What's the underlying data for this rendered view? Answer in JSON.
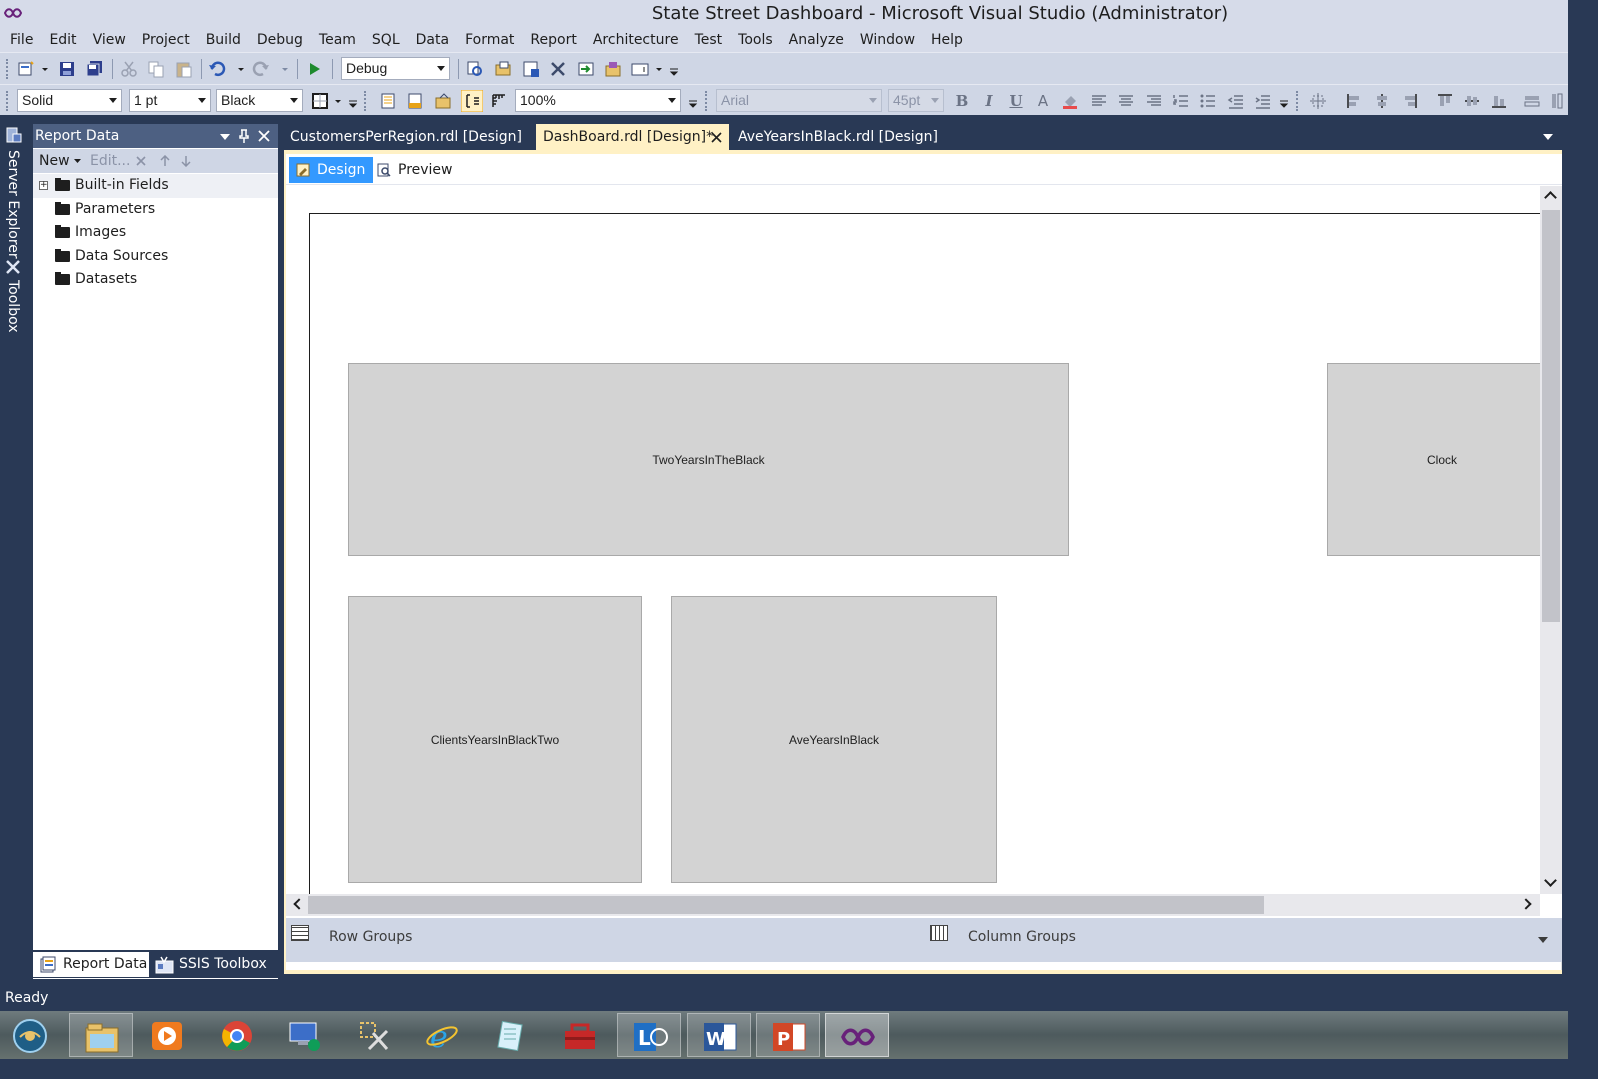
{
  "window": {
    "title": "State Street Dashboard - Microsoft Visual Studio (Administrator)"
  },
  "menu": [
    "File",
    "Edit",
    "View",
    "Project",
    "Build",
    "Debug",
    "Team",
    "SQL",
    "Data",
    "Format",
    "Report",
    "Architecture",
    "Test",
    "Tools",
    "Analyze",
    "Window",
    "Help"
  ],
  "toolbar1": {
    "config": "Debug"
  },
  "toolbar2": {
    "border_style": "Solid",
    "border_width": "1 pt",
    "border_color": "Black",
    "zoom": "100%",
    "font_name": "Arial",
    "font_size": "45pt",
    "bold": "B",
    "italic": "I",
    "underline": "U",
    "font_color": "A"
  },
  "side_tabs": {
    "server_explorer": "Server Explorer",
    "toolbox": "Toolbox"
  },
  "report_data": {
    "title": "Report Data",
    "pin": "↓",
    "close": "✕",
    "new_label": "New",
    "edit_label": "Edit...",
    "items": [
      "Built-in Fields",
      "Parameters",
      "Images",
      "Data Sources",
      "Datasets"
    ]
  },
  "panel_tabs": {
    "report_data": "Report Data",
    "ssis_toolbox": "SSIS Toolbox"
  },
  "doc_tabs": [
    {
      "label": "CustomersPerRegion.rdl [Design]"
    },
    {
      "label": "DashBoard.rdl [Design]*"
    },
    {
      "label": "AveYearsInBlack.rdl [Design]"
    }
  ],
  "view_tabs": {
    "design": "Design",
    "preview": "Preview"
  },
  "subreports": [
    "TwoYearsInTheBlack",
    "Clock",
    "ClientsYearsInBlackTwo",
    "AveYearsInBlack"
  ],
  "groups": {
    "row": "Row Groups",
    "column": "Column Groups"
  },
  "status": {
    "text": "Ready"
  },
  "colors": {
    "chrome": "#293955",
    "menu_bg": "#d6dbe9",
    "active_tab": "#fff1c5",
    "selection_blue": "#3399ff",
    "subreport_fill": "#d3d3d3"
  },
  "taskbar_icons": [
    "start-orb-icon",
    "file-explorer-icon",
    "media-player-icon",
    "chrome-icon",
    "remote-desktop-icon",
    "tools-icon",
    "internet-explorer-icon",
    "notepad-icon",
    "toolbox-icon",
    "lync-icon",
    "word-icon",
    "powerpoint-icon",
    "visual-studio-icon"
  ]
}
